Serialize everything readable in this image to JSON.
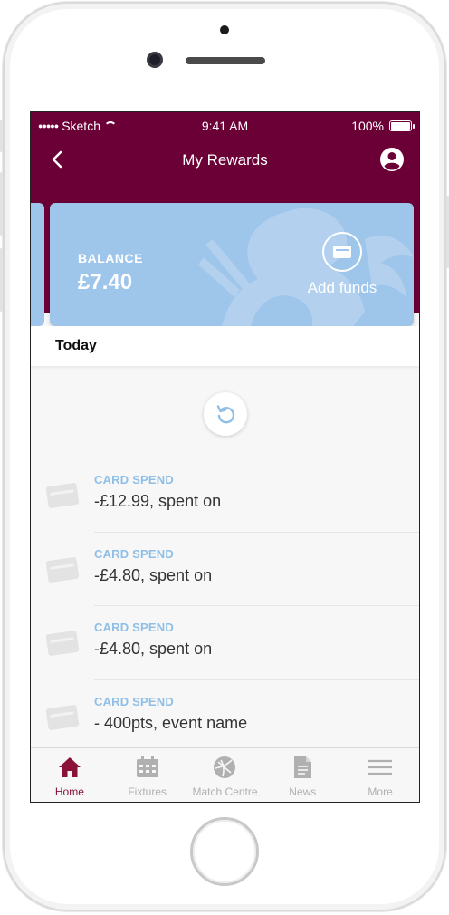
{
  "status_bar": {
    "carrier": "Sketch",
    "time": "9:41 AM",
    "battery": "100%"
  },
  "header": {
    "title": "My Rewards"
  },
  "balance_card": {
    "label": "BALANCE",
    "value": "£7.40",
    "add_funds_label": "Add funds"
  },
  "section": {
    "day_label": "Today"
  },
  "transactions": [
    {
      "type": "CARD SPEND",
      "description": "-£12.99, spent on"
    },
    {
      "type": "CARD SPEND",
      "description": "-£4.80, spent on"
    },
    {
      "type": "CARD SPEND",
      "description": "-£4.80, spent on"
    },
    {
      "type": "CARD SPEND",
      "description": "- 400pts, event name"
    }
  ],
  "tabs": [
    {
      "label": "Home",
      "icon": "home-icon",
      "active": true
    },
    {
      "label": "Fixtures",
      "icon": "calendar-icon",
      "active": false
    },
    {
      "label": "Match Centre",
      "icon": "ball-icon",
      "active": false
    },
    {
      "label": "News",
      "icon": "document-icon",
      "active": false
    },
    {
      "label": "More",
      "icon": "menu-icon",
      "active": false
    }
  ],
  "colors": {
    "brand": "#6b0036",
    "card": "#9ec5ea",
    "accent_text": "#8fbfe6",
    "tab_active": "#8a1238",
    "tab_inactive": "#b0b0b0"
  }
}
